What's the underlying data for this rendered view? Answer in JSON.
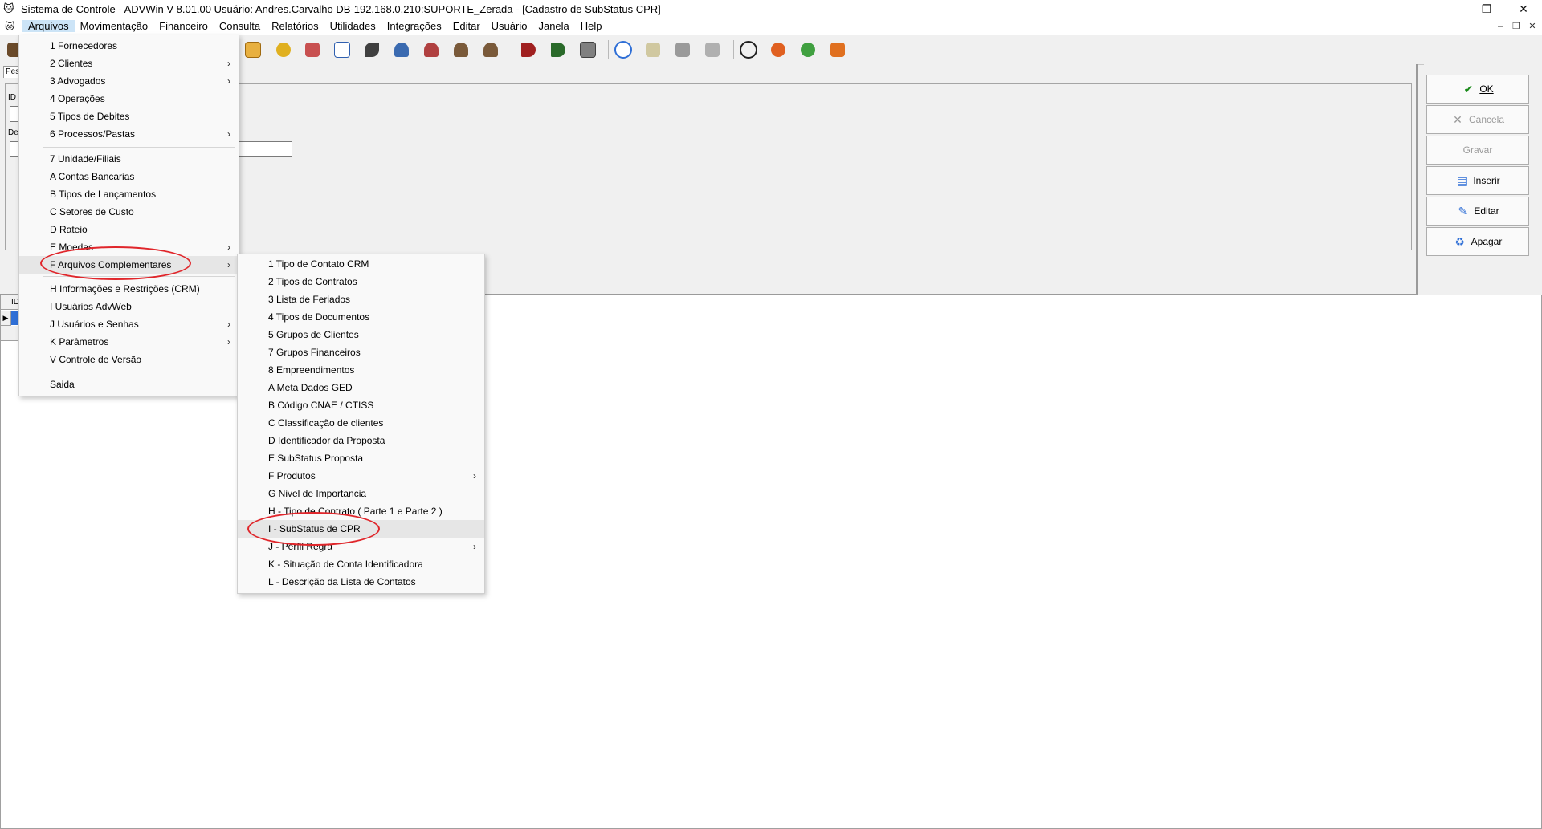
{
  "window": {
    "title": "Sistema de Controle - ADVWin  V 8.01.00  Usuário: Andres.Carvalho  DB-192.168.0.210:SUPORTE_Zerada - [Cadastro de SubStatus CPR]",
    "minimize_glyph": "—",
    "maximize_glyph": "❐",
    "close_glyph": "✕"
  },
  "menubar": {
    "items": [
      "Arquivos",
      "Movimentação",
      "Financeiro",
      "Consulta",
      "Relatórios",
      "Utilidades",
      "Integrações",
      "Editar",
      "Usuário",
      "Janela",
      "Help"
    ],
    "mdi_controls": [
      "–",
      "❐",
      "✕"
    ]
  },
  "toolbar": {
    "icons": [
      "calendar-icon",
      "globe-icon",
      "report-icon",
      "chart-icon",
      "check-icon",
      "user-icon",
      "users-icon",
      "group-icon",
      "group-icon",
      "arrow-icon",
      "arrow-icon",
      "camera-icon",
      "refresh-icon",
      "document-icon",
      "print-icon",
      "document-icon",
      "scissors-icon",
      "sync-icon",
      "swap-icon",
      "exit-icon"
    ]
  },
  "form": {
    "tab_label": "Pes",
    "id_label": "ID",
    "desc_label": "De"
  },
  "actions": {
    "ok": "OK",
    "cancela": "Cancela",
    "gravar": "Gravar",
    "inserir": "Inserir",
    "editar": "Editar",
    "apagar": "Apagar"
  },
  "grid": {
    "header_label": "ID"
  },
  "arquivos_menu": {
    "items": [
      {
        "label": "1 Fornecedores",
        "submenu": false
      },
      {
        "label": "2 Clientes",
        "submenu": true
      },
      {
        "label": "3 Advogados",
        "submenu": true
      },
      {
        "label": "4 Operações",
        "submenu": false
      },
      {
        "label": "5 Tipos de Debites",
        "submenu": false
      },
      {
        "label": "6 Processos/Pastas",
        "submenu": true
      },
      {
        "label": "7 Unidade/Filiais",
        "submenu": false
      },
      {
        "label": "A Contas Bancarias",
        "submenu": false
      },
      {
        "label": "B Tipos de Lançamentos",
        "submenu": false
      },
      {
        "label": "C Setores de Custo",
        "submenu": false
      },
      {
        "label": "D Rateio",
        "submenu": false
      },
      {
        "label": "E Moedas",
        "submenu": true
      },
      {
        "label": "F Arquivos Complementares",
        "submenu": true
      },
      {
        "label": "H Informações e Restrições (CRM)",
        "submenu": false
      },
      {
        "label": "I Usuários AdvWeb",
        "submenu": false
      },
      {
        "label": "J Usuários e Senhas",
        "submenu": true
      },
      {
        "label": "K Parâmetros",
        "submenu": true
      },
      {
        "label": "V Controle de Versão",
        "submenu": false
      },
      {
        "label": "Saida",
        "submenu": false
      }
    ]
  },
  "complementares_menu": {
    "items": [
      {
        "label": "1 Tipo de Contato CRM",
        "submenu": false
      },
      {
        "label": "2 Tipos de Contratos",
        "submenu": false
      },
      {
        "label": "3 Lista de Feriados",
        "submenu": false
      },
      {
        "label": "4 Tipos de Documentos",
        "submenu": false
      },
      {
        "label": "5 Grupos de Clientes",
        "submenu": false
      },
      {
        "label": "7 Grupos Financeiros",
        "submenu": false
      },
      {
        "label": "8 Empreendimentos",
        "submenu": false
      },
      {
        "label": "A Meta Dados GED",
        "submenu": false
      },
      {
        "label": "B Código CNAE / CTISS",
        "submenu": false
      },
      {
        "label": "C Classificação de clientes",
        "submenu": false
      },
      {
        "label": "D Identificador da Proposta",
        "submenu": false
      },
      {
        "label": "E SubStatus Proposta",
        "submenu": false
      },
      {
        "label": "F Produtos",
        "submenu": true
      },
      {
        "label": "G Nivel de Importancia",
        "submenu": false
      },
      {
        "label": "H - Tipo de Contrato ( Parte 1 e Parte 2 )",
        "submenu": false
      },
      {
        "label": "I - SubStatus de CPR",
        "submenu": false
      },
      {
        "label": "J - Perfil Regra",
        "submenu": true
      },
      {
        "label": "K - Situação de Conta Identificadora",
        "submenu": false
      },
      {
        "label": "L - Descrição da Lista de Contatos",
        "submenu": false
      }
    ]
  },
  "colors": {
    "annotation": "#e0262b",
    "selection": "#2f6fd6",
    "menu_highlight": "#cce4f7"
  }
}
